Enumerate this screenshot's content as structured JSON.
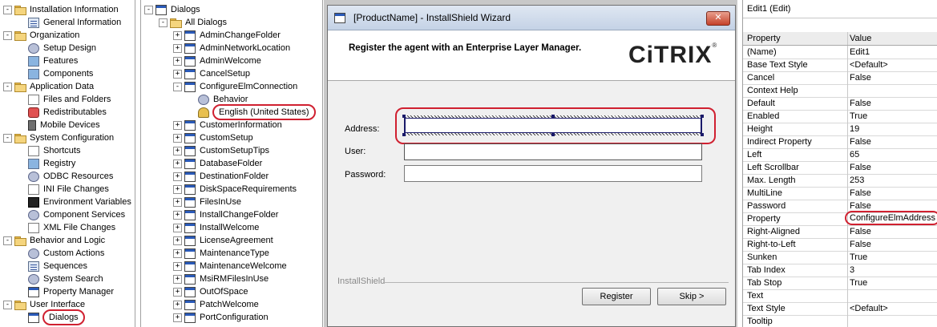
{
  "left_tree": [
    {
      "label": "Installation Information",
      "level": 0,
      "toggle": "−",
      "icon": "folder"
    },
    {
      "label": "General Information",
      "level": 1,
      "icon": "list"
    },
    {
      "label": "Organization",
      "level": 0,
      "toggle": "−",
      "icon": "folder"
    },
    {
      "label": "Setup Design",
      "level": 1,
      "icon": "gear"
    },
    {
      "label": "Features",
      "level": 1,
      "icon": "cube"
    },
    {
      "label": "Components",
      "level": 1,
      "icon": "cube"
    },
    {
      "label": "Application Data",
      "level": 0,
      "toggle": "−",
      "icon": "folder"
    },
    {
      "label": "Files and Folders",
      "level": 1,
      "icon": "doc"
    },
    {
      "label": "Redistributables",
      "level": 1,
      "icon": "red"
    },
    {
      "label": "Mobile Devices",
      "level": 1,
      "icon": "phone"
    },
    {
      "label": "System Configuration",
      "level": 0,
      "toggle": "−",
      "icon": "folder"
    },
    {
      "label": "Shortcuts",
      "level": 1,
      "icon": "doc"
    },
    {
      "label": "Registry",
      "level": 1,
      "icon": "cube"
    },
    {
      "label": "ODBC Resources",
      "level": 1,
      "icon": "gear"
    },
    {
      "label": "INI File Changes",
      "level": 1,
      "icon": "doc"
    },
    {
      "label": "Environment Variables",
      "level": 1,
      "icon": "term"
    },
    {
      "label": "Component Services",
      "level": 1,
      "icon": "gear"
    },
    {
      "label": "XML File Changes",
      "level": 1,
      "icon": "doc"
    },
    {
      "label": "Behavior and Logic",
      "level": 0,
      "toggle": "−",
      "icon": "folder"
    },
    {
      "label": "Custom Actions",
      "level": 1,
      "icon": "gear"
    },
    {
      "label": "Sequences",
      "level": 1,
      "icon": "list"
    },
    {
      "label": "System Search",
      "level": 1,
      "icon": "gear"
    },
    {
      "label": "Property Manager",
      "level": 1,
      "icon": "dlg"
    },
    {
      "label": "User Interface",
      "level": 0,
      "toggle": "−",
      "icon": "folder"
    },
    {
      "label": "Dialogs",
      "level": 1,
      "icon": "dlg",
      "highlight": true
    }
  ],
  "mid_tree": [
    {
      "label": "Dialogs",
      "level": 0,
      "toggle": "−",
      "icon": "dlg"
    },
    {
      "label": "All Dialogs",
      "level": 1,
      "toggle": "−",
      "icon": "folder"
    },
    {
      "label": "AdminChangeFolder",
      "level": 2,
      "toggle": "+",
      "icon": "dlg"
    },
    {
      "label": "AdminNetworkLocation",
      "level": 2,
      "toggle": "+",
      "icon": "dlg"
    },
    {
      "label": "AdminWelcome",
      "level": 2,
      "toggle": "+",
      "icon": "dlg"
    },
    {
      "label": "CancelSetup",
      "level": 2,
      "toggle": "+",
      "icon": "dlg"
    },
    {
      "label": "ConfigureElmConnection",
      "level": 2,
      "toggle": "−",
      "icon": "dlg"
    },
    {
      "label": "Behavior",
      "level": 3,
      "icon": "gear"
    },
    {
      "label": "English (United States)",
      "level": 3,
      "icon": "person",
      "highlight": true
    },
    {
      "label": "CustomerInformation",
      "level": 2,
      "toggle": "+",
      "icon": "dlg"
    },
    {
      "label": "CustomSetup",
      "level": 2,
      "toggle": "+",
      "icon": "dlg"
    },
    {
      "label": "CustomSetupTips",
      "level": 2,
      "toggle": "+",
      "icon": "dlg"
    },
    {
      "label": "DatabaseFolder",
      "level": 2,
      "toggle": "+",
      "icon": "dlg"
    },
    {
      "label": "DestinationFolder",
      "level": 2,
      "toggle": "+",
      "icon": "dlg"
    },
    {
      "label": "DiskSpaceRequirements",
      "level": 2,
      "toggle": "+",
      "icon": "dlg"
    },
    {
      "label": "FilesInUse",
      "level": 2,
      "toggle": "+",
      "icon": "dlg"
    },
    {
      "label": "InstallChangeFolder",
      "level": 2,
      "toggle": "+",
      "icon": "dlg"
    },
    {
      "label": "InstallWelcome",
      "level": 2,
      "toggle": "+",
      "icon": "dlg"
    },
    {
      "label": "LicenseAgreement",
      "level": 2,
      "toggle": "+",
      "icon": "dlg"
    },
    {
      "label": "MaintenanceType",
      "level": 2,
      "toggle": "+",
      "icon": "dlg"
    },
    {
      "label": "MaintenanceWelcome",
      "level": 2,
      "toggle": "+",
      "icon": "dlg"
    },
    {
      "label": "MsiRMFilesInUse",
      "level": 2,
      "toggle": "+",
      "icon": "dlg"
    },
    {
      "label": "OutOfSpace",
      "level": 2,
      "toggle": "+",
      "icon": "dlg"
    },
    {
      "label": "PatchWelcome",
      "level": 2,
      "toggle": "+",
      "icon": "dlg"
    },
    {
      "label": "PortConfiguration",
      "level": 2,
      "toggle": "+",
      "icon": "dlg"
    }
  ],
  "wizard": {
    "title": "[ProductName] - InstallShield Wizard",
    "close_label": "✕",
    "heading": "Register the agent with an Enterprise Layer Manager.",
    "logo_text": "CiTRIX",
    "logo_mark": "®",
    "address_label": "Address:",
    "user_label": "User:",
    "password_label": "Password:",
    "brand": "InstallShield",
    "register_label": "Register",
    "skip_label": "Skip >"
  },
  "properties": {
    "title": "Edit1 (Edit)",
    "col_property": "Property",
    "col_value": "Value",
    "rows": [
      {
        "k": "(Name)",
        "v": "Edit1"
      },
      {
        "k": "Base Text Style",
        "v": "<Default>"
      },
      {
        "k": "Cancel",
        "v": "False"
      },
      {
        "k": "Context Help",
        "v": ""
      },
      {
        "k": "Default",
        "v": "False"
      },
      {
        "k": "Enabled",
        "v": "True"
      },
      {
        "k": "Height",
        "v": "19"
      },
      {
        "k": "Indirect Property",
        "v": "False"
      },
      {
        "k": "Left",
        "v": "65"
      },
      {
        "k": "Left Scrollbar",
        "v": "False"
      },
      {
        "k": "Max. Length",
        "v": "253"
      },
      {
        "k": "MultiLine",
        "v": "False"
      },
      {
        "k": "Password",
        "v": "False"
      },
      {
        "k": "Property",
        "v": "ConfigureElmAddress",
        "highlight": true
      },
      {
        "k": "Right-Aligned",
        "v": "False"
      },
      {
        "k": "Right-to-Left",
        "v": "False"
      },
      {
        "k": "Sunken",
        "v": "True"
      },
      {
        "k": "Tab Index",
        "v": "3"
      },
      {
        "k": "Tab Stop",
        "v": "True"
      },
      {
        "k": "Text",
        "v": ""
      },
      {
        "k": "Text Style",
        "v": "<Default>"
      },
      {
        "k": "Tooltip",
        "v": ""
      }
    ]
  }
}
